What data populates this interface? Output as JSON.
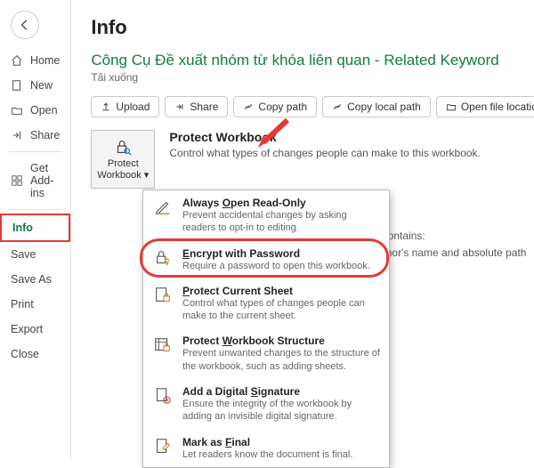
{
  "sidebar": {
    "items": [
      {
        "label": "Home"
      },
      {
        "label": "New"
      },
      {
        "label": "Open"
      },
      {
        "label": "Share"
      },
      {
        "label": "Get Add-ins"
      },
      {
        "label": "Info"
      },
      {
        "label": "Save"
      },
      {
        "label": "Save As"
      },
      {
        "label": "Print"
      },
      {
        "label": "Export"
      },
      {
        "label": "Close"
      }
    ]
  },
  "page": {
    "title": "Info"
  },
  "doc": {
    "title": "Công Cụ Đề xuất nhóm từ khóa liên quan - Related Keyword",
    "subtitle": "Tải xuống"
  },
  "actions": {
    "upload": "Upload",
    "share": "Share",
    "copyPath": "Copy path",
    "copyLocalPath": "Copy local path",
    "openLocation": "Open file location"
  },
  "protect": {
    "button1": "Protect",
    "button2": "Workbook",
    "heading": "Protect Workbook",
    "desc": "Control what types of changes people can make to this workbook."
  },
  "inspect": {
    "line1": "hat it contains:",
    "line2": "th, author's name and absolute path"
  },
  "menu": {
    "items": [
      {
        "title": "Always ",
        "u": "O",
        "rest": "pen Read-Only",
        "desc": "Prevent accidental changes by asking readers to opt-in to editing."
      },
      {
        "title": "",
        "u": "E",
        "rest": "ncrypt with Password",
        "desc": "Require a password to open this workbook."
      },
      {
        "title": "",
        "u": "P",
        "rest": "rotect Current Sheet",
        "desc": "Control what types of changes people can make to the current sheet."
      },
      {
        "title": "Protect ",
        "u": "W",
        "rest": "orkbook Structure",
        "desc": "Prevent unwanted changes to the structure of the workbook, such as adding sheets."
      },
      {
        "title": "Add a Digital ",
        "u": "S",
        "rest": "ignature",
        "desc": "Ensure the integrity of the workbook by adding an invisible digital signature."
      },
      {
        "title": "Mark as ",
        "u": "F",
        "rest": "inal",
        "desc": "Let readers know the document is final."
      }
    ]
  }
}
